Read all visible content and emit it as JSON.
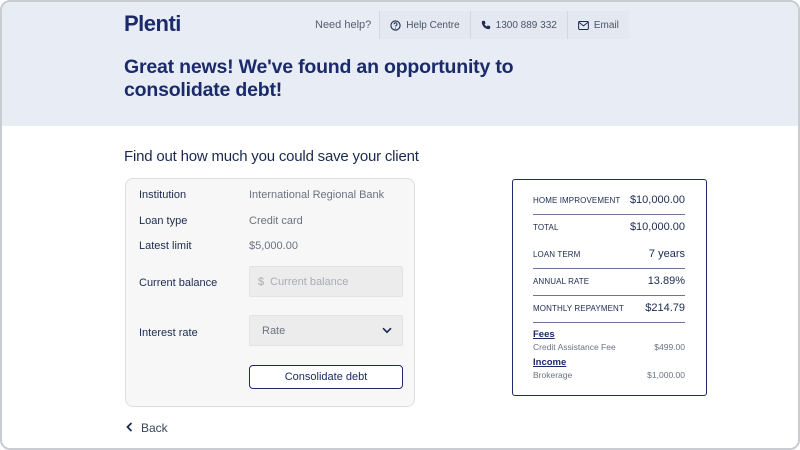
{
  "brand": {
    "logo": "Plenti"
  },
  "help": {
    "label": "Need help?",
    "links": [
      {
        "label": "Help Centre",
        "icon": "question-circle-icon"
      },
      {
        "label": "1300 889 332",
        "icon": "phone-icon"
      },
      {
        "label": "Email",
        "icon": "envelope-icon"
      }
    ]
  },
  "headline": "Great news! We've found an opportunity to consolidate debt!",
  "subhead": "Find out how much you could save your client",
  "loan": {
    "institution_label": "Institution",
    "institution_value": "International Regional Bank",
    "type_label": "Loan type",
    "type_value": "Credit card",
    "limit_label": "Latest limit",
    "limit_value": "$5,000.00",
    "balance_label": "Current balance",
    "balance_prefix": "$",
    "balance_placeholder": "Current balance",
    "rate_label": "Interest rate",
    "rate_selected": "Rate",
    "consolidate_button": "Consolidate debt"
  },
  "back_label": "Back",
  "summary": {
    "rows": [
      {
        "label": "HOME IMPROVEMENT",
        "value": "$10,000.00"
      },
      {
        "label": "TOTAL",
        "value": "$10,000.00"
      },
      {
        "label": "LOAN TERM",
        "value": "7 years"
      },
      {
        "label": "ANNUAL RATE",
        "value": "13.89%"
      },
      {
        "label": "MONTHLY REPAYMENT",
        "value": "$214.79"
      }
    ],
    "fees_heading": "Fees",
    "fees": [
      {
        "label": "Credit Assistance Fee",
        "value": "$499.00"
      }
    ],
    "income_heading": "Income",
    "income": [
      {
        "label": "Brokerage",
        "value": "$1,000.00"
      }
    ]
  },
  "colors": {
    "brand": "#1a2a6c",
    "hero_bg": "#e8edf5",
    "card_bg": "#f7f7f7"
  }
}
